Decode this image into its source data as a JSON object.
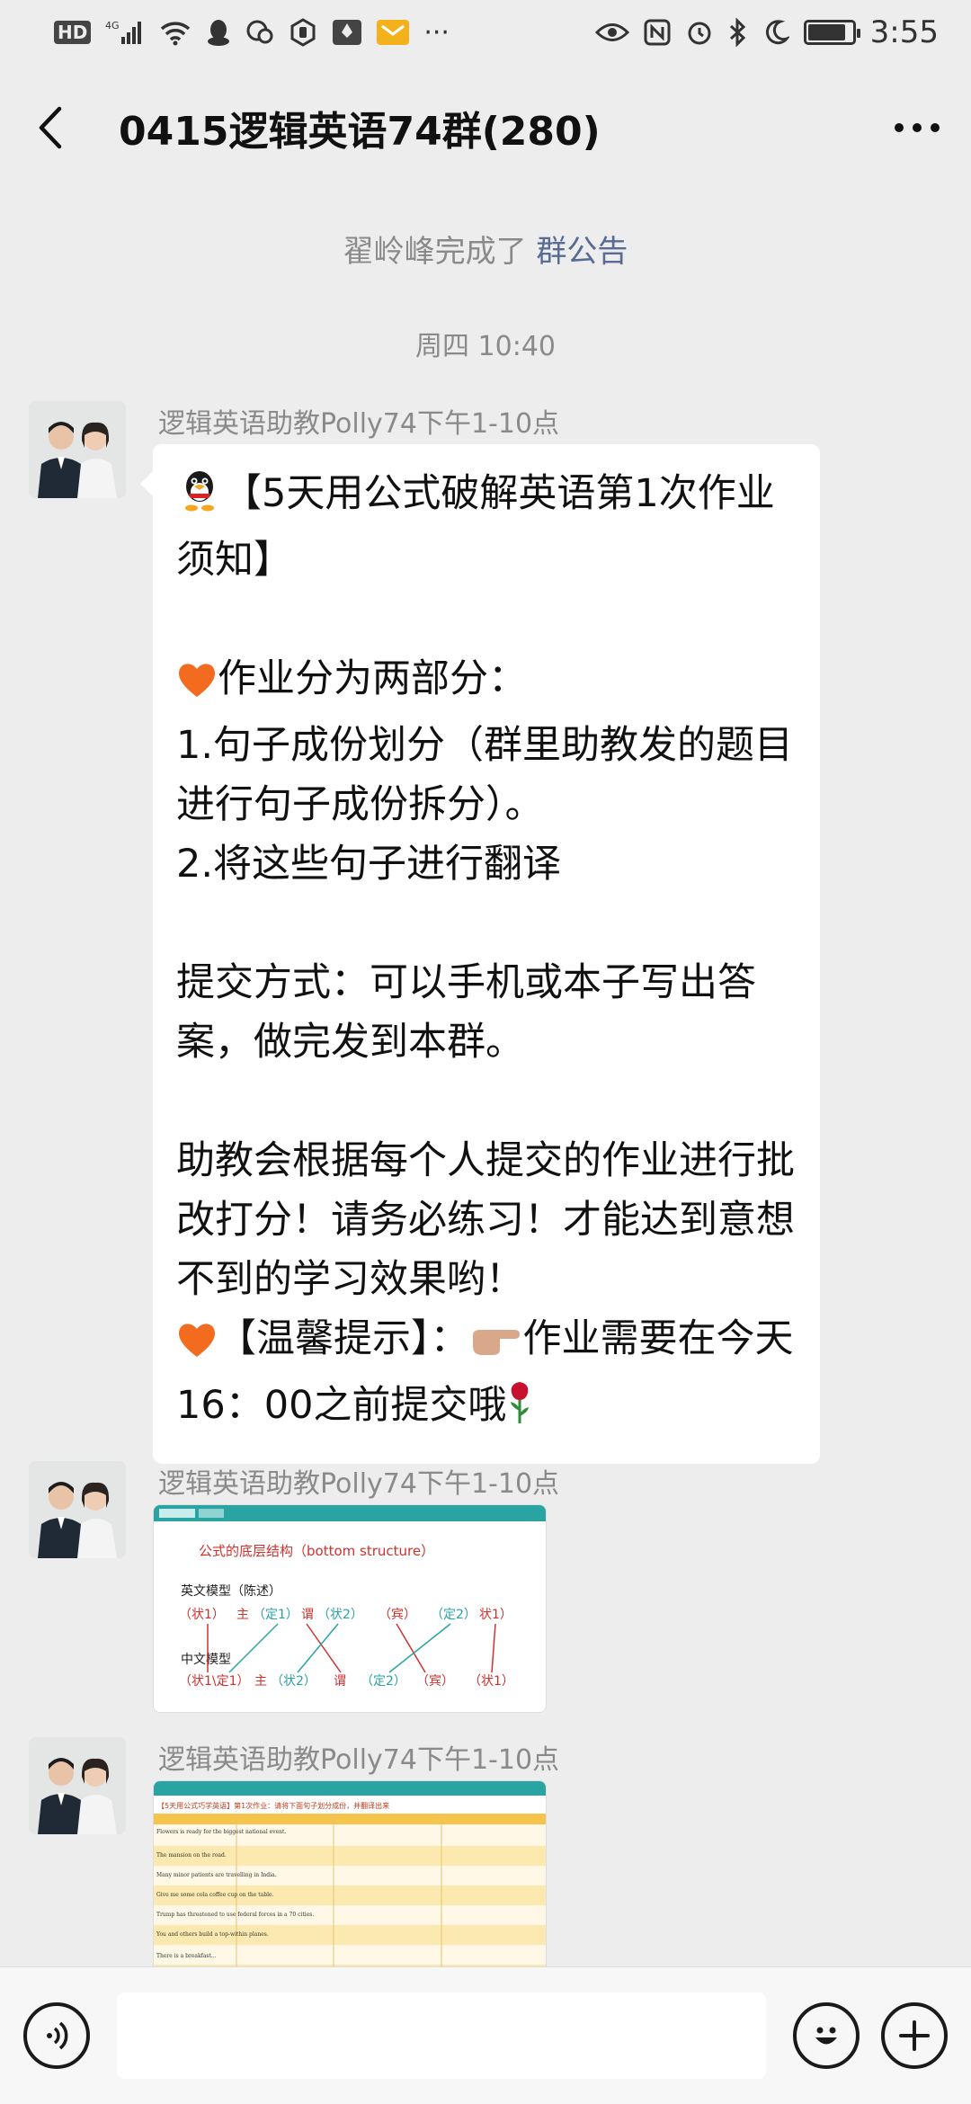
{
  "status_bar": {
    "hd": "HD",
    "network": "4G",
    "time": "3:55",
    "battery_level": 0.85,
    "more": "···"
  },
  "header": {
    "title": "0415逻辑英语74群(280)"
  },
  "notice": {
    "actor_text": "翟岭峰完成了",
    "link_text": "群公告"
  },
  "timestamp": "周四 10:40",
  "messages": [
    {
      "sender": "逻辑英语助教Polly74下午1-10点",
      "type": "text",
      "lines": [
        "【5天用公式破解英语第1次作业须知】",
        "",
        "作业分为两部分：",
        "1.句子成份划分（群里助教发的题目进行句子成份拆分）。",
        "2.将这些句子进行翻译",
        "",
        "提交方式：可以手机或本子写出答案，做完发到本群。",
        "",
        "助教会根据每个人提交的作业进行批改打分！请务必练习！才能达到意想不到的学习效果哟！",
        "【温馨提示】：",
        "作业需要在今天16：00之前提交哦"
      ]
    },
    {
      "sender": "逻辑英语助教Polly74下午1-10点",
      "type": "image",
      "image": {
        "heading": "公式的底层结构（bottom structure）",
        "row1_label": "英文模型（陈述）",
        "row1": [
          "（状1）",
          "主",
          "（定1）",
          "谓",
          "（状2）",
          "（宾）",
          "（定2）",
          "状1）"
        ],
        "row2_label": "中文模型",
        "row2": [
          "（状1\\定1）",
          "主",
          "（状2）",
          "谓",
          "（定2）",
          "（宾）",
          "（状1）"
        ]
      }
    },
    {
      "sender": "逻辑英语助教Polly74下午1-10点",
      "type": "image",
      "image": {
        "heading": "【5天用公式巧学英语】第1次作业：请将下面句子划分成份，并翻译出来",
        "rows": [
          "Flowers is ready for the biggest national event.",
          "The mansion on the road.",
          "Many minor patients are travelling in India.",
          "Give me some cola coffee cup on the table.",
          "Trump has threatened to use federal forces in a 70 cities.",
          "You and others build a top-within planes.",
          "There is a breakfast..."
        ]
      }
    }
  ],
  "colors": {
    "background": "#ededed",
    "bubble": "#ffffff",
    "link": "#576b95",
    "muted": "#8a8a8a",
    "teal": "#2aa3a3",
    "red": "#d0312d"
  }
}
